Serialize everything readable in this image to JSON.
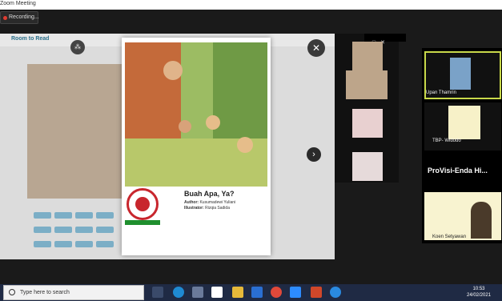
{
  "window": {
    "title": "Zoom Meeting"
  },
  "recording": {
    "label": "Recording..."
  },
  "share": {
    "brand": "Room to Read"
  },
  "book": {
    "title": "Buah Apa, Ya?",
    "author_label": "Author:",
    "author": "Kusumadewi Yuliani",
    "illustrator_label": "Illustrator:",
    "illustrator": "Rizqia Sadida"
  },
  "participants": [
    {
      "name": "Upan Thamrin"
    },
    {
      "name": "TBP- Widodo"
    },
    {
      "name": "ProVisi-Enda Hi..."
    },
    {
      "name": "Koen Setyawan"
    }
  ],
  "taskbar": {
    "search_placeholder": "Type here to search",
    "time": "10:53",
    "date": "24/02/2021"
  }
}
